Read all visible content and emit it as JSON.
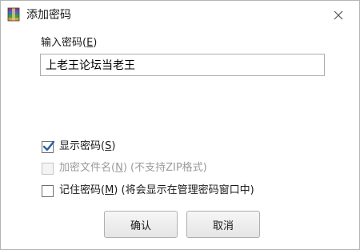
{
  "window": {
    "title": "添加密码",
    "icon": "winrar-archive-icon",
    "close_icon": "close-icon"
  },
  "password": {
    "label_prefix": "输入密码(",
    "label_accel": "E",
    "label_suffix": ")",
    "value": "上老王论坛当老王"
  },
  "options": {
    "show_password": {
      "label_prefix": "显示密码(",
      "accel": "S",
      "label_suffix": ")",
      "checked": true,
      "enabled": true
    },
    "encrypt_filenames": {
      "label_prefix": "加密文件名(",
      "accel": "N",
      "label_suffix": ") (不支持ZIP格式)",
      "checked": false,
      "enabled": false
    },
    "remember_password": {
      "label_prefix": "记住密码(",
      "accel": "M",
      "label_suffix": ") (将会显示在管理密码窗口中)",
      "checked": false,
      "enabled": true
    }
  },
  "buttons": {
    "ok": "确认",
    "cancel": "取消"
  },
  "colors": {
    "check_mark": "#2a5ea8",
    "disabled_text": "#9a9a9a"
  }
}
